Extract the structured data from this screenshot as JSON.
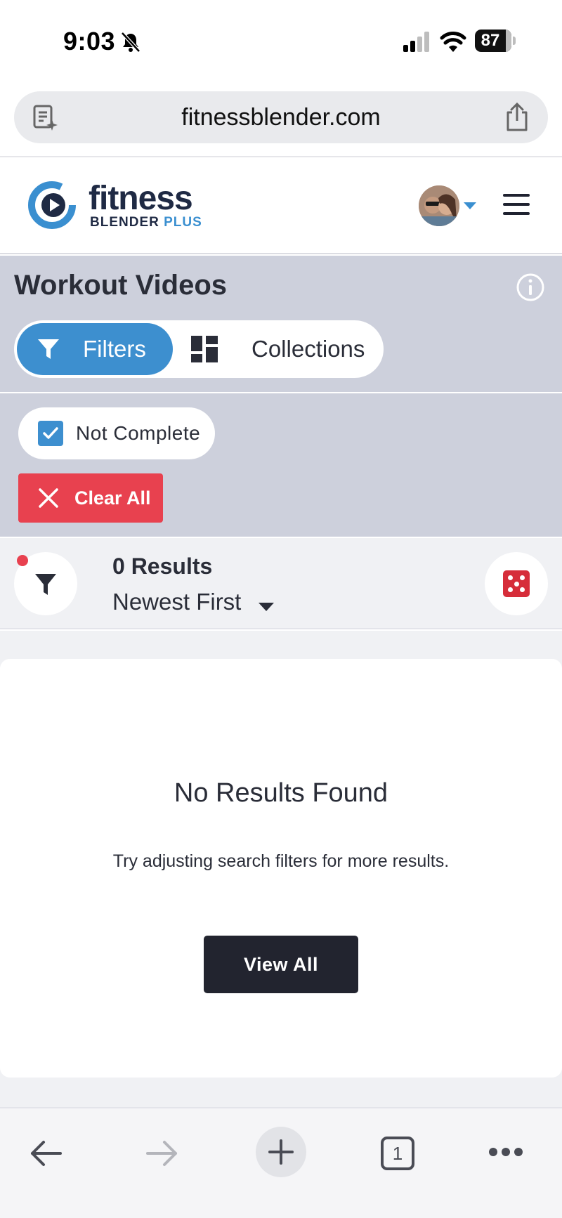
{
  "status_bar": {
    "time": "9:03",
    "battery": "87",
    "icons": [
      "bell-slash-icon",
      "cellular-signal-icon",
      "wifi-icon",
      "battery-icon"
    ]
  },
  "browser": {
    "url": "fitnessblender.com",
    "icons": [
      "reader-mode-icon",
      "share-icon"
    ]
  },
  "site_header": {
    "logo_word": "fitness",
    "logo_sub": "BLENDER",
    "logo_plus": "PLUS",
    "brand_color": "#3a8fd0",
    "icons": [
      "logo-play-icon",
      "avatar",
      "chevron-down-icon",
      "hamburger-menu-icon"
    ]
  },
  "workout": {
    "title": "Workout Videos",
    "tabs": [
      {
        "label": "Filters",
        "active": true,
        "icon": "filter-funnel-icon"
      },
      {
        "label": "Collections",
        "active": false,
        "icon": "grid-icon"
      }
    ],
    "panel_color": "#cdd0dc",
    "accent": "#3d8fcf"
  },
  "active_filters": {
    "chips": [
      {
        "label": "Not Complete",
        "checked": true
      }
    ],
    "clear_label": "Clear All",
    "clear_color": "#e8414f"
  },
  "results": {
    "count_label": "0 Results",
    "sort_value": "Newest First",
    "icons": [
      "filter-funnel-icon",
      "random-dice-icon"
    ]
  },
  "empty_state": {
    "title": "No Results Found",
    "subtitle": "Try adjusting search filters for more results.",
    "button_label": "View All"
  },
  "toolbar": {
    "tab_count": "1",
    "icons": [
      "back-arrow-icon",
      "forward-arrow-icon",
      "new-tab-plus-icon",
      "tabs-icon",
      "more-icon"
    ]
  }
}
